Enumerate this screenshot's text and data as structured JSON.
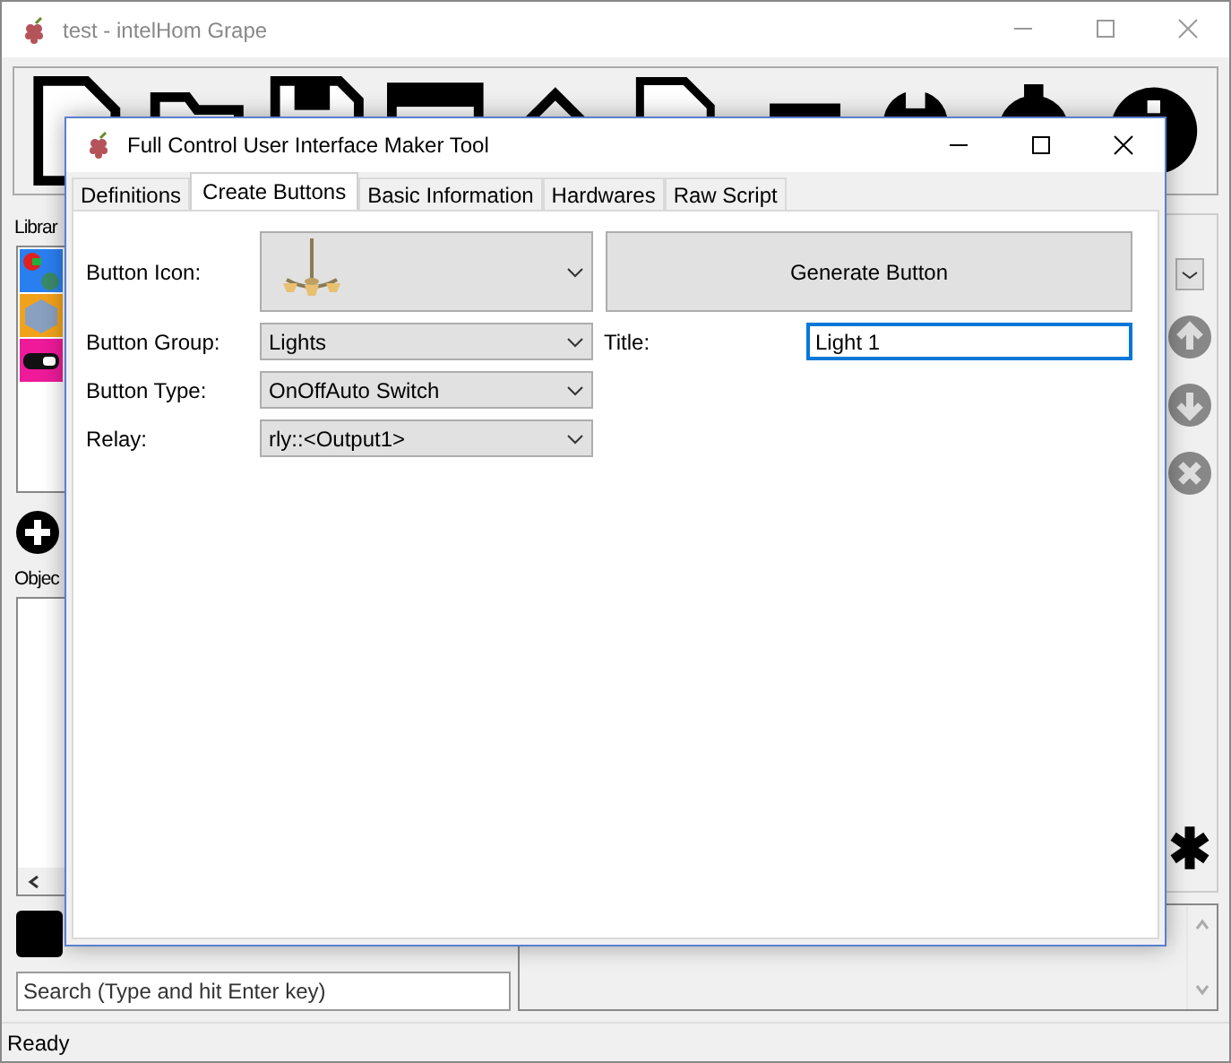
{
  "main_window": {
    "title": "test - intelHom Grape"
  },
  "library": {
    "label": "Librar"
  },
  "objects": {
    "label": "Objec"
  },
  "search": {
    "placeholder": "Search (Type and hit Enter key)"
  },
  "status_bar": {
    "text": "Ready"
  },
  "dialog": {
    "title": "Full Control User Interface Maker Tool",
    "tabs": [
      {
        "label": "Definitions",
        "selected": false
      },
      {
        "label": "Create Buttons",
        "selected": true
      },
      {
        "label": "Basic Information",
        "selected": false
      },
      {
        "label": "Hardwares",
        "selected": false
      },
      {
        "label": "Raw Script",
        "selected": false
      }
    ],
    "button_icon": {
      "label": "Button Icon:"
    },
    "generate_button": "Generate Button",
    "fields": [
      {
        "label": "Button Group:",
        "value": "Lights"
      },
      {
        "label": "Button Type:",
        "value": "OnOffAuto Switch"
      },
      {
        "label": "Relay:",
        "value": "rly::<Output1>"
      }
    ],
    "title_field": {
      "label": "Title:",
      "value": "Light 1",
      "focused": true
    }
  }
}
